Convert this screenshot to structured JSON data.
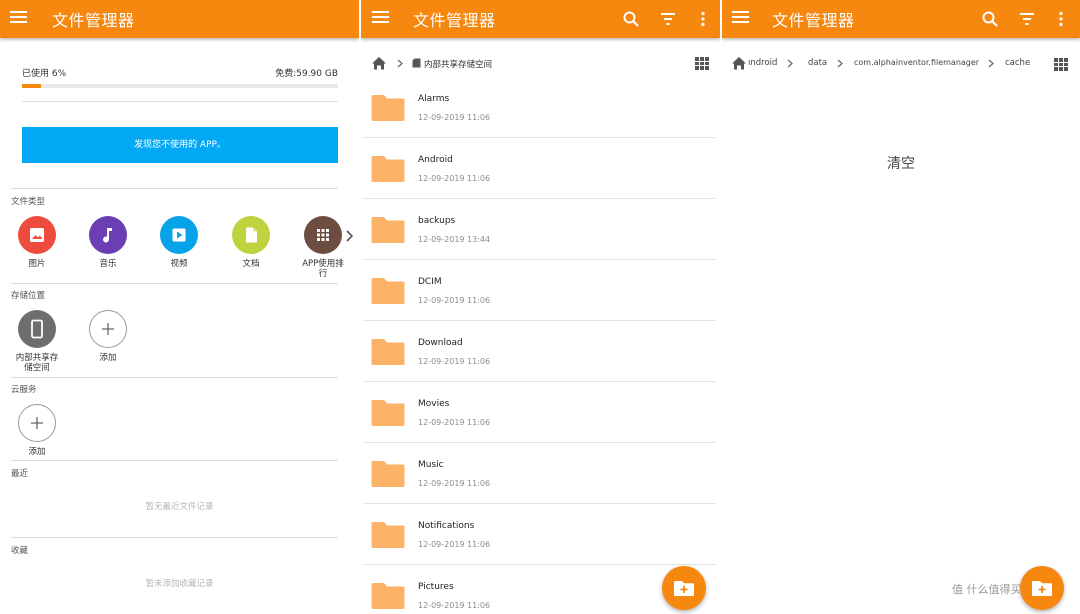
{
  "colors": {
    "accent": "#f6870f",
    "banner": "#03a9f4",
    "folder": "#fcb267"
  },
  "left_panel": {
    "title": "文件管理器",
    "storage": {
      "used_label": "已使用 6%",
      "free_label": "免费:59.90 GB",
      "used_fraction": 0.06
    },
    "banner_text": "发现您不使用的 APP。",
    "file_types": {
      "title": "文件类型",
      "items": [
        {
          "label": "图片",
          "icon": "image-icon",
          "color": "#ee4b3f"
        },
        {
          "label": "音乐",
          "icon": "music-note-icon",
          "color": "#6b3fb3"
        },
        {
          "label": "视频",
          "icon": "video-play-icon",
          "color": "#07a3e8"
        },
        {
          "label": "文档",
          "icon": "document-icon",
          "color": "#bed33d"
        },
        {
          "label_line1": "APP使用排",
          "label_line2": "行",
          "icon": "apps-grid-icon",
          "color": "#6d4c41"
        }
      ]
    },
    "storage_locations": {
      "title": "存储位置",
      "internal_line1": "内部共享存",
      "internal_line2": "储空间",
      "add_label": "添加"
    },
    "cloud": {
      "title": "云服务",
      "add_label": "添加"
    },
    "recent": {
      "title": "最近",
      "empty": "暂无最近文件记录"
    },
    "favorites": {
      "title": "收藏",
      "empty": "暂未添加收藏记录"
    }
  },
  "middle_panel": {
    "title": "文件管理器",
    "breadcrumb": "内部共享存储空间",
    "folders": [
      {
        "name": "Alarms",
        "date": "12-09-2019 11:06"
      },
      {
        "name": "Android",
        "date": "12-09-2019 11:06"
      },
      {
        "name": "backups",
        "date": "12-09-2019 13:44"
      },
      {
        "name": "DCIM",
        "date": "12-09-2019 11:06"
      },
      {
        "name": "Download",
        "date": "12-09-2019 11:06"
      },
      {
        "name": "Movies",
        "date": "12-09-2019 11:06"
      },
      {
        "name": "Music",
        "date": "12-09-2019 11:06"
      },
      {
        "name": "Notifications",
        "date": "12-09-2019 11:06"
      },
      {
        "name": "Pictures",
        "date": "12-09-2019 11:06"
      }
    ]
  },
  "right_panel": {
    "title": "文件管理器",
    "breadcrumb": [
      "ındroid",
      "data",
      "com.alphainventor.filemanager",
      "cache"
    ],
    "empty_text": "清空"
  },
  "watermark": "值 什么值得买"
}
